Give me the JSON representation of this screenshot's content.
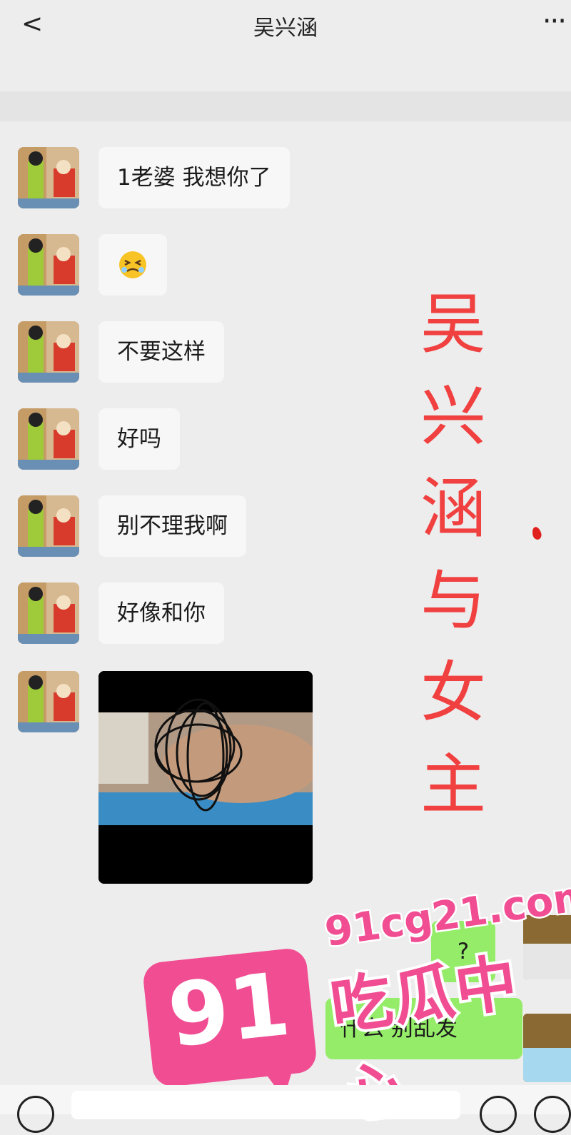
{
  "header": {
    "back_symbol": "<",
    "title": "吴兴涵",
    "more_symbol": "···"
  },
  "messages": [
    {
      "text": "1老婆  我想你了"
    },
    {
      "text": "😖"
    },
    {
      "text": "不要这样"
    },
    {
      "text": "好吗"
    },
    {
      "text": "别不理我啊"
    },
    {
      "text": "好像和你"
    }
  ],
  "sent_messages": [
    {
      "text": "?"
    },
    {
      "text": "什么  别乱发"
    }
  ],
  "overlay_text": {
    "chars": [
      "吴",
      "兴",
      "涵",
      "与",
      "女",
      "主"
    ]
  },
  "brand": {
    "number": "91",
    "url": "91cg21.com",
    "name": "吃瓜中心"
  },
  "colors": {
    "background": "#ededed",
    "bubble_received": "#f7f7f7",
    "bubble_sent": "#95ec69",
    "overlay_red": "#f04040",
    "brand_pink": "#f04d92"
  }
}
